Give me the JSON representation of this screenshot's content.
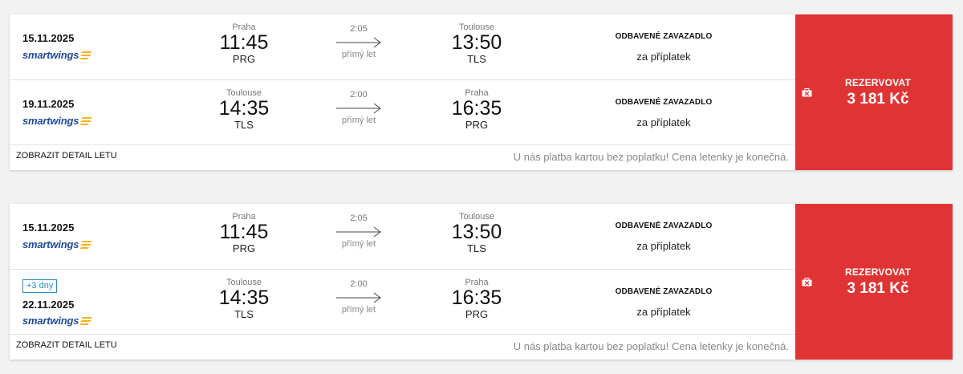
{
  "airline_logo_text": "smartwings",
  "results": [
    {
      "legs": [
        {
          "date": "15.11.2025",
          "badge": "",
          "from_city": "Praha",
          "dep_time": "11:45",
          "from_code": "PRG",
          "duration": "2:05",
          "direct": "přímý let",
          "to_city": "Toulouse",
          "arr_time": "13:50",
          "to_code": "TLS",
          "baggage_title": "ODBAVENÉ ZAVAZADLO",
          "baggage_sub": "za příplatek"
        },
        {
          "date": "19.11.2025",
          "badge": "",
          "from_city": "Toulouse",
          "dep_time": "14:35",
          "from_code": "TLS",
          "duration": "2:00",
          "direct": "přímý let",
          "to_city": "Praha",
          "arr_time": "16:35",
          "to_code": "PRG",
          "baggage_title": "ODBAVENÉ ZAVAZADLO",
          "baggage_sub": "za příplatek"
        }
      ],
      "detail_link": "ZOBRAZIT DETAIL LETU",
      "payment_note": "U nás platba kartou bez poplatku! Cena letenky je konečná.",
      "cta_label": "REZERVOVAT",
      "price": "3 181 Kč"
    },
    {
      "legs": [
        {
          "date": "15.11.2025",
          "badge": "",
          "from_city": "Praha",
          "dep_time": "11:45",
          "from_code": "PRG",
          "duration": "2:05",
          "direct": "přímý let",
          "to_city": "Toulouse",
          "arr_time": "13:50",
          "to_code": "TLS",
          "baggage_title": "ODBAVENÉ ZAVAZADLO",
          "baggage_sub": "za příplatek"
        },
        {
          "date": "22.11.2025",
          "badge": "+3 dny",
          "from_city": "Toulouse",
          "dep_time": "14:35",
          "from_code": "TLS",
          "duration": "2:00",
          "direct": "přímý let",
          "to_city": "Praha",
          "arr_time": "16:35",
          "to_code": "PRG",
          "baggage_title": "ODBAVENÉ ZAVAZADLO",
          "baggage_sub": "za příplatek"
        }
      ],
      "detail_link": "ZOBRAZIT DETAIL LETU",
      "payment_note": "U nás platba kartou bez poplatku! Cena letenky je konečná.",
      "cta_label": "REZERVOVAT",
      "price": "3 181 Kč"
    }
  ],
  "colors": {
    "cta_background": "#e03434",
    "airline_blue": "#1f4a9a",
    "airline_yellow": "#f5b21b",
    "badge_blue": "#2a8ec6"
  },
  "icons": {
    "baggage": "suitcase-icon",
    "arrow": "arrow-right-icon",
    "airline": "smartwings-logo"
  }
}
